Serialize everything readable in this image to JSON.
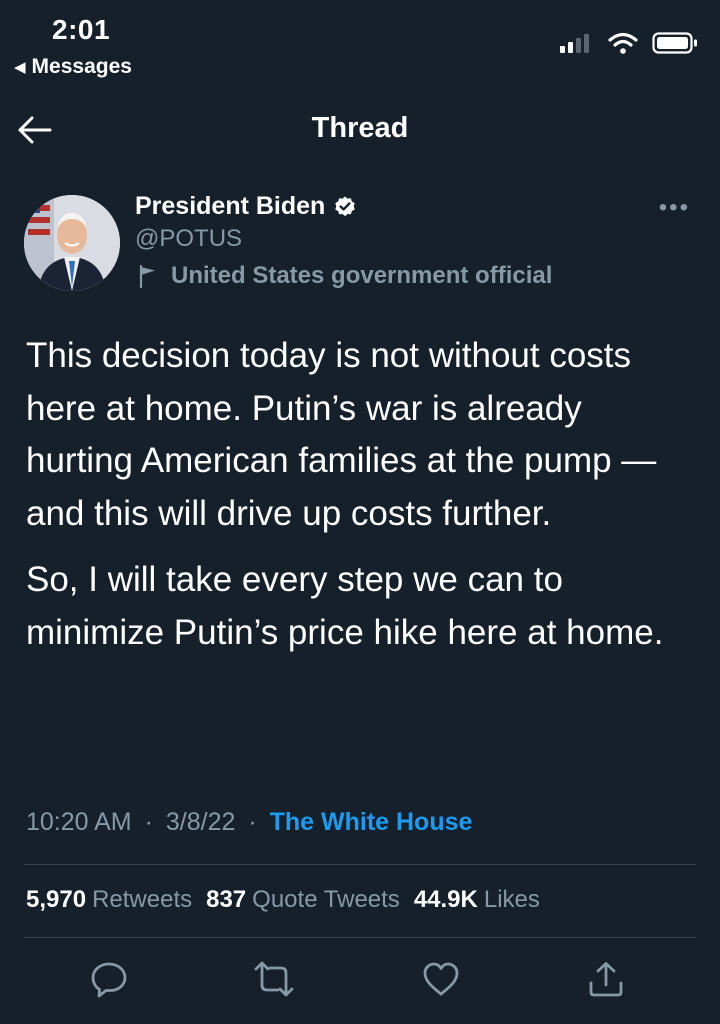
{
  "status_bar": {
    "time": "2:01",
    "back_app": "Messages"
  },
  "nav": {
    "title": "Thread"
  },
  "tweet": {
    "author_name": "President Biden",
    "handle": "@POTUS",
    "account_label": "United States government official",
    "paragraphs": [
      "This decision today is not without costs here at home. Putin’s war is already hurting American families at the pump — and this will drive up costs further.",
      "So, I will take every step we can to minimize Putin’s price hike here at home."
    ],
    "time": "10:20 AM",
    "date": "3/8/22",
    "source": "The White House",
    "separator": "·"
  },
  "stats": {
    "retweets": {
      "count": "5,970",
      "label": "Retweets"
    },
    "quote_tweets": {
      "count": "837",
      "label": "Quote Tweets"
    },
    "likes": {
      "count": "44.9K",
      "label": "Likes"
    }
  },
  "colors": {
    "background": "#15202b",
    "secondary_text": "#8899a6",
    "link": "#1d9bf0",
    "divider": "#38444d"
  },
  "icons": [
    "back-arrow-icon",
    "verified-badge-icon",
    "flag-icon",
    "more-icon",
    "reply-icon",
    "retweet-icon",
    "like-icon",
    "share-icon",
    "signal-icon",
    "wifi-icon",
    "battery-icon"
  ]
}
